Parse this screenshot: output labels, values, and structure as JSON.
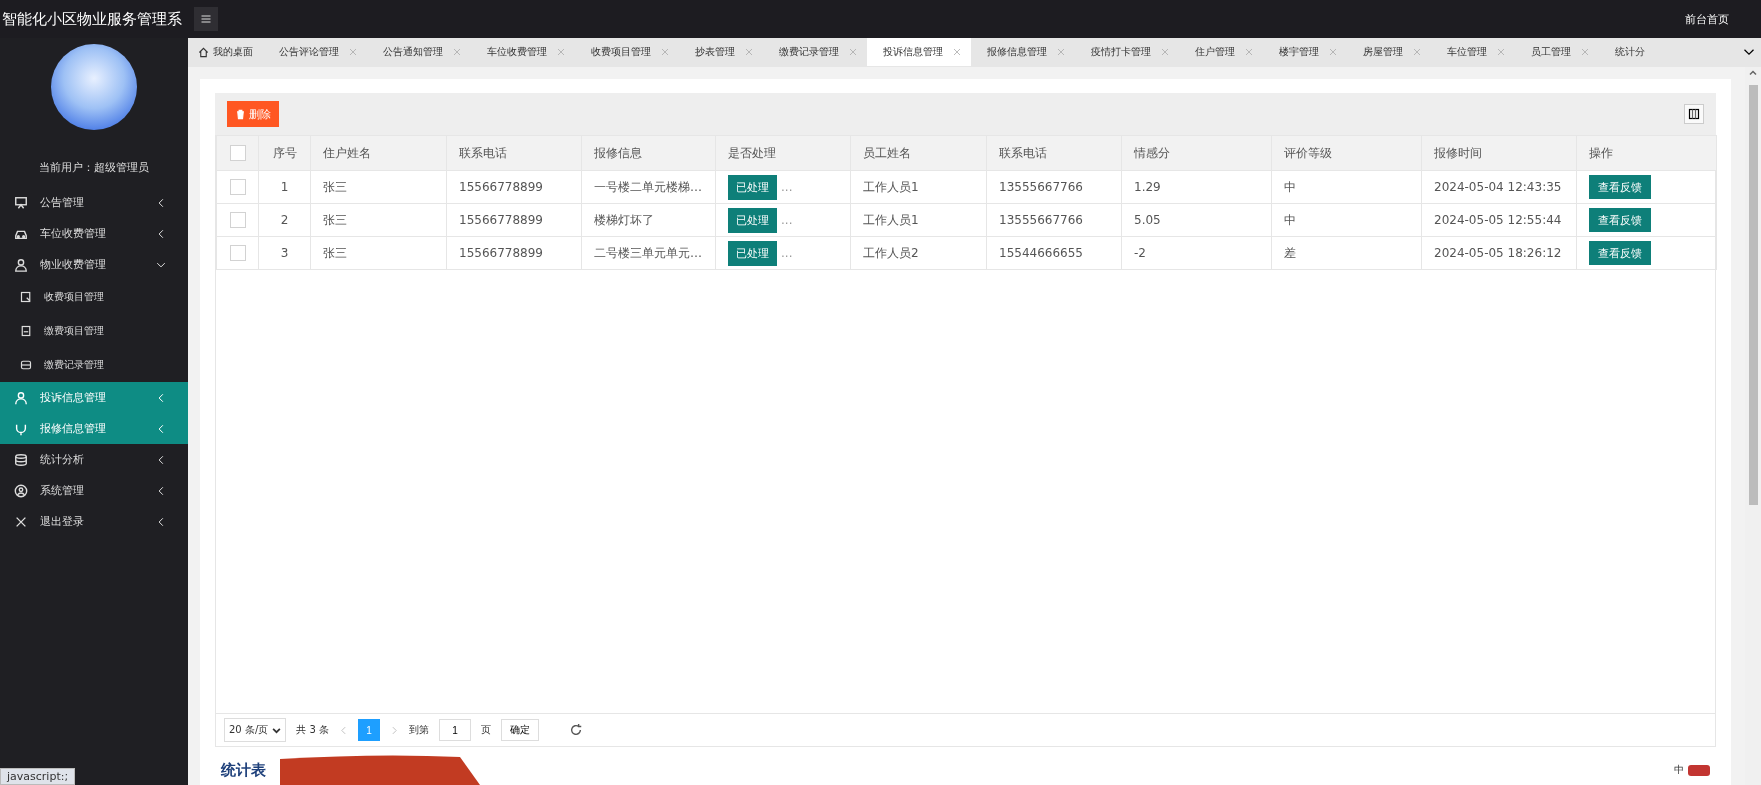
{
  "app": {
    "title": "智能化小区物业服务管理系",
    "home_link": "前台首页"
  },
  "sidebar": {
    "user": "当前用户：超级管理员",
    "items": [
      {
        "label": "公告管理",
        "expanded": false,
        "selected": false
      },
      {
        "label": "车位收费管理",
        "expanded": false,
        "selected": false
      },
      {
        "label": "物业收费管理",
        "expanded": true,
        "selected": false,
        "children": [
          {
            "label": "收费项目管理"
          },
          {
            "label": "缴费项目管理"
          },
          {
            "label": "缴费记录管理"
          }
        ]
      },
      {
        "label": "投诉信息管理",
        "expanded": false,
        "selected": true
      },
      {
        "label": "报修信息管理",
        "expanded": false,
        "selected": true
      },
      {
        "label": "统计分析",
        "expanded": false,
        "selected": false
      },
      {
        "label": "系统管理",
        "expanded": false,
        "selected": false
      },
      {
        "label": "退出登录",
        "expanded": false,
        "selected": false
      }
    ]
  },
  "tabs": [
    {
      "label": "我的桌面",
      "kind": "home",
      "selected": false
    },
    {
      "label": "公告评论管理",
      "kind": "closable",
      "selected": false
    },
    {
      "label": "公告通知管理",
      "kind": "closable",
      "selected": false
    },
    {
      "label": "车位收费管理",
      "kind": "closable",
      "selected": false
    },
    {
      "label": "收费项目管理",
      "kind": "closable",
      "selected": false
    },
    {
      "label": "抄表管理",
      "kind": "closable",
      "selected": false
    },
    {
      "label": "缴费记录管理",
      "kind": "closable",
      "selected": false
    },
    {
      "label": "投诉信息管理",
      "kind": "closable",
      "selected": true
    },
    {
      "label": "报修信息管理",
      "kind": "closable",
      "selected": false
    },
    {
      "label": "疫情打卡管理",
      "kind": "closable",
      "selected": false
    },
    {
      "label": "住户管理",
      "kind": "closable",
      "selected": false
    },
    {
      "label": "楼宇管理",
      "kind": "closable",
      "selected": false
    },
    {
      "label": "房屋管理",
      "kind": "closable",
      "selected": false
    },
    {
      "label": "车位管理",
      "kind": "closable",
      "selected": false
    },
    {
      "label": "员工管理",
      "kind": "closable",
      "selected": false
    },
    {
      "label": "统计分",
      "kind": "cut",
      "selected": false
    }
  ],
  "toolbar": {
    "delete_button": "删除"
  },
  "table": {
    "header_checked": false,
    "columns": [
      "序号",
      "住户姓名",
      "联系电话",
      "报修信息",
      "是否处理",
      "员工姓名",
      "联系电话",
      "情感分",
      "评价等级",
      "报修时间",
      "操作"
    ],
    "rows": [
      {
        "checked": false,
        "cells": [
          "1",
          "张三",
          "15566778899",
          "一号楼二单元楼梯…",
          "已处理",
          "工作人员1",
          "13555667766",
          "1.29",
          "中",
          "2024-05-04 12:43:35",
          "查看反馈"
        ],
        "status_more": "..."
      },
      {
        "checked": false,
        "cells": [
          "2",
          "张三",
          "15566778899",
          "楼梯灯坏了",
          "已处理",
          "工作人员1",
          "13555667766",
          "5.05",
          "中",
          "2024-05-05 12:55:44",
          "查看反馈"
        ],
        "status_more": "..."
      },
      {
        "checked": false,
        "cells": [
          "3",
          "张三",
          "15566778899",
          "二号楼三单元单元…",
          "已处理",
          "工作人员2",
          "15544666655",
          "-2",
          "差",
          "2024-05-05 18:26:12",
          "查看反馈"
        ],
        "status_more": "..."
      }
    ]
  },
  "pagination": {
    "page_size": "20 条/页",
    "total": "共 3 条",
    "pages": [
      {
        "label": "1",
        "selected": true
      }
    ],
    "goto_label": "到第",
    "goto_value": "1",
    "page_unit": "页",
    "confirm": "确定"
  },
  "chart_panel": {
    "title": "统计表",
    "legend": [
      {
        "label": "中",
        "color": "#c23531"
      }
    ]
  },
  "status_bar": "javascript:;"
}
